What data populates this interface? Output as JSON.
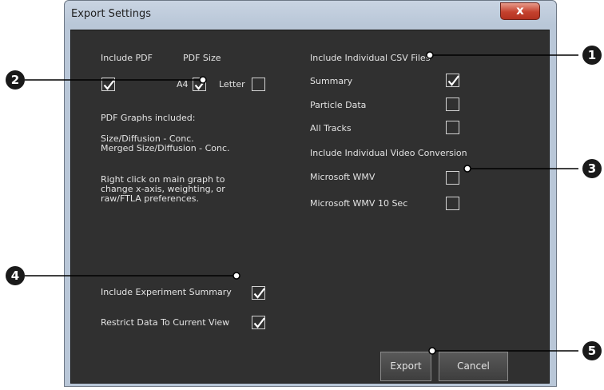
{
  "window": {
    "title": "Export Settings",
    "close_glyph": "x"
  },
  "pdf": {
    "include_label": "Include PDF",
    "size_label": "PDF Size",
    "a4_label": "A4",
    "letter_label": "Letter",
    "graphs_heading": "PDF Graphs included:",
    "graphs_list": "Size/Diffusion - Conc.\nMerged Size/Diffusion - Conc.",
    "hint": "Right click on main graph to change x-axis, weighting, or raw/FTLA preferences."
  },
  "csv": {
    "heading": "Include Individual CSV Files",
    "items": [
      {
        "label": "Summary",
        "checked": true
      },
      {
        "label": "Particle Data",
        "checked": false
      },
      {
        "label": "All Tracks",
        "checked": false
      }
    ]
  },
  "video": {
    "heading": "Include Individual Video Conversion",
    "items": [
      {
        "label": "Microsoft WMV",
        "checked": false
      },
      {
        "label": "Microsoft WMV 10 Sec",
        "checked": false
      }
    ]
  },
  "options": {
    "experiment_summary_label": "Include Experiment Summary",
    "restrict_label": "Restrict Data To Current View"
  },
  "checkbox_state": {
    "include_pdf": true,
    "a4": true,
    "letter": false,
    "experiment_summary": true,
    "restrict": true
  },
  "buttons": {
    "export": "Export",
    "cancel": "Cancel"
  },
  "callouts": [
    "1",
    "2",
    "3",
    "4",
    "5"
  ],
  "colors": {
    "panel_bg": "#303030",
    "text": "#e3e3e3",
    "callout": "#1a1a1a",
    "title_bar": "#c9d4e2",
    "close": "#c4412e"
  }
}
